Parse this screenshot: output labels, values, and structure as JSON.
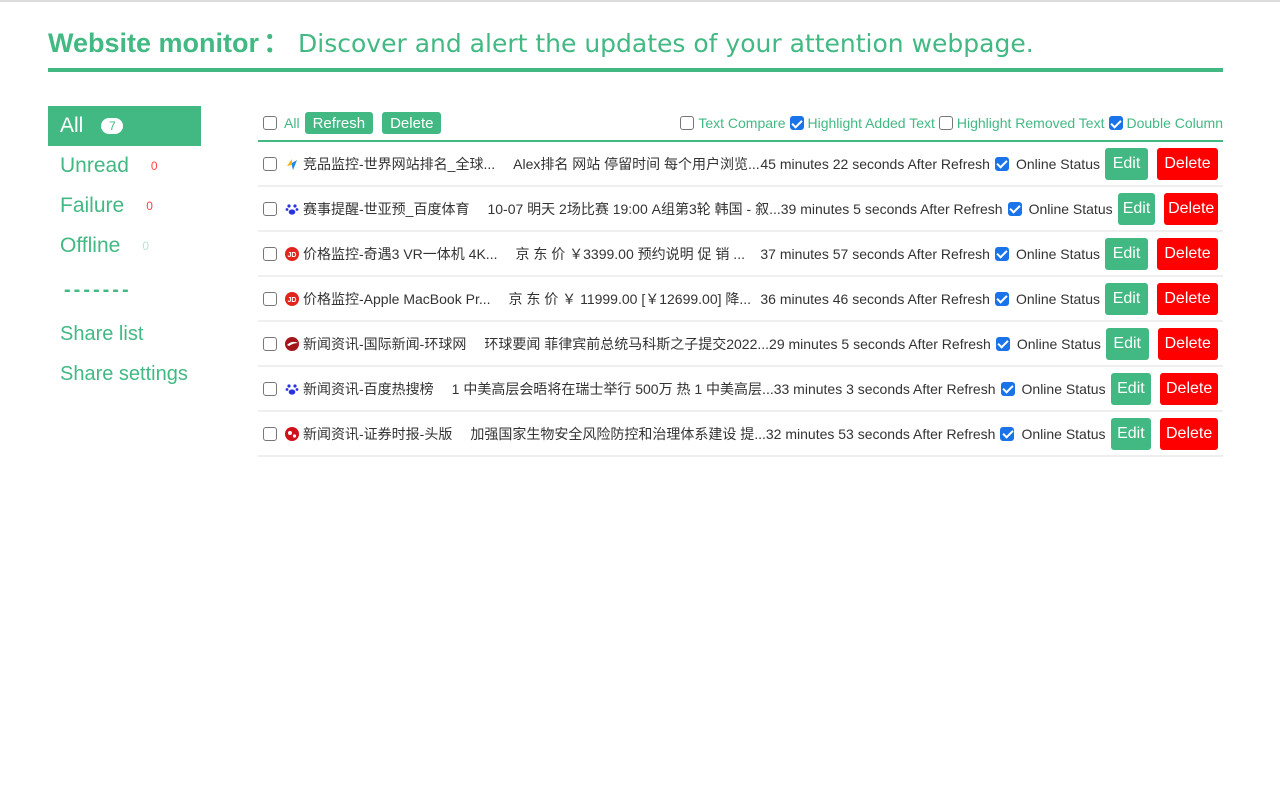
{
  "header": {
    "title": "Website monitor",
    "separator": "：",
    "subtitle": "Discover and alert the updates of your attention webpage."
  },
  "sidebar": {
    "items": [
      {
        "label": "All",
        "count": "7"
      },
      {
        "label": "Unread",
        "count": "0"
      },
      {
        "label": "Failure",
        "count": "0"
      },
      {
        "label": "Offline",
        "count": "0"
      }
    ],
    "divider": "-------",
    "links": [
      {
        "label": "Share list"
      },
      {
        "label": "Share settings"
      }
    ]
  },
  "toolbar": {
    "select_all_label": "All",
    "refresh_label": "Refresh",
    "delete_label": "Delete",
    "options": [
      {
        "label": "Text Compare",
        "checked": false
      },
      {
        "label": "Highlight Added Text",
        "checked": true
      },
      {
        "label": "Highlight Removed Text",
        "checked": false
      },
      {
        "label": "Double Column",
        "checked": true
      }
    ]
  },
  "colors": {
    "accent": "#42b983",
    "danger": "#ff0000",
    "checkbox_checked": "#1a73e8"
  },
  "rows": [
    {
      "icon": "alexa-icon",
      "name": "竞品监控-世界网站排名_全球...",
      "snippet": "Alex排名 网站 停留时间 每个用户浏览...",
      "time": "45 minutes 22 seconds After Refresh",
      "status_label": "Online Status",
      "online": true,
      "edit": "Edit",
      "delete": "Delete"
    },
    {
      "icon": "baidu-paw-icon",
      "name": "赛事提醒-世亚预_百度体育",
      "snippet": "10-07 明天 2场比赛 19:00 A组第3轮 韩国 - 叙...",
      "time": "39 minutes 5 seconds After Refresh",
      "status_label": "Online Status",
      "online": true,
      "edit": "Edit",
      "delete": "Delete"
    },
    {
      "icon": "jd-icon",
      "name": "价格监控-奇遇3 VR一体机 4K...",
      "snippet": "京 东 价 ￥3399.00 预约说明 促      销 ...",
      "time": "37 minutes 57 seconds After Refresh",
      "status_label": "Online Status",
      "online": true,
      "edit": "Edit",
      "delete": "Delete"
    },
    {
      "icon": "jd-icon",
      "name": "价格监控-Apple MacBook Pr...",
      "snippet": "京 东 价 ￥ 11999.00 [￥12699.00] 降...",
      "time": "36 minutes 46 seconds After Refresh",
      "status_label": "Online Status",
      "online": true,
      "edit": "Edit",
      "delete": "Delete"
    },
    {
      "icon": "huanqiu-icon",
      "name": "新闻资讯-国际新闻-环球网",
      "snippet": "环球要闻 菲律宾前总统马科斯之子提交2022...",
      "time": "29 minutes 5 seconds After Refresh",
      "status_label": "Online Status",
      "online": true,
      "edit": "Edit",
      "delete": "Delete"
    },
    {
      "icon": "baidu-paw-icon",
      "name": "新闻资讯-百度热搜榜",
      "snippet": "1 中美高层会晤将在瑞士举行 500万 热 1 中美高层...",
      "time": "33 minutes 3 seconds After Refresh",
      "status_label": "Online Status",
      "online": true,
      "edit": "Edit",
      "delete": "Delete"
    },
    {
      "icon": "stcn-icon",
      "name": "新闻资讯-证券时报-头版",
      "snippet": "加强国家生物安全风险防控和治理体系建设 提...",
      "time": "32 minutes 53 seconds After Refresh",
      "status_label": "Online Status",
      "online": true,
      "edit": "Edit",
      "delete": "Delete"
    }
  ]
}
